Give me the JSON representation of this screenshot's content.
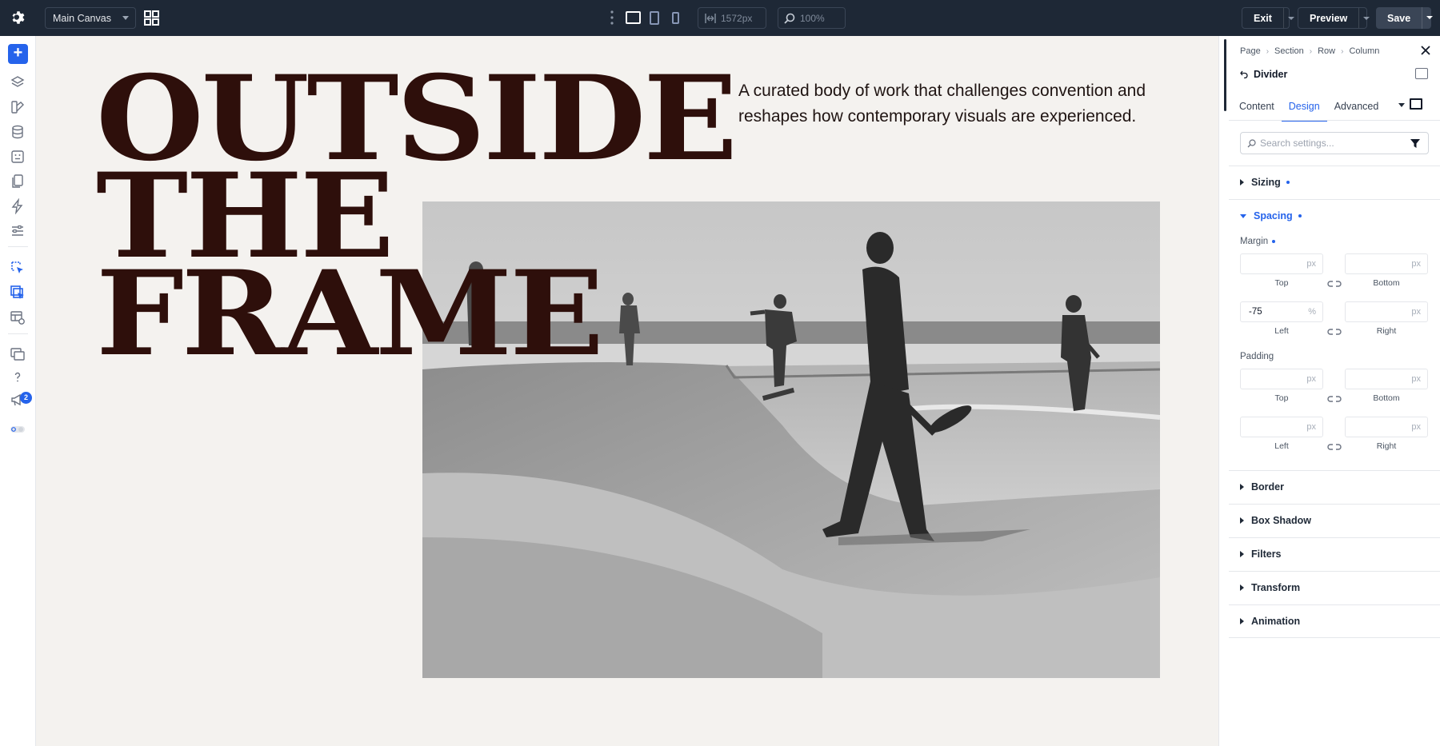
{
  "topbar": {
    "canvas_name": "Main Canvas",
    "width_value": "1572px",
    "zoom_value": "100%",
    "exit_label": "Exit",
    "preview_label": "Preview",
    "save_label": "Save"
  },
  "sidebar": {
    "notification_count": "2",
    "accent": "#2563eb"
  },
  "canvas": {
    "headline_lines": [
      "OUTSIDE",
      "THE",
      "FRAME"
    ],
    "tagline": "A curated body of work that challenges convention and reshapes how contemporary visuals are experienced.",
    "headline_color": "#2e0f0b"
  },
  "panel": {
    "breadcrumb": [
      "Page",
      "Section",
      "Row",
      "Column"
    ],
    "element_title": "Divider",
    "tabs": [
      "Content",
      "Design",
      "Advanced"
    ],
    "active_tab": "Design",
    "search_placeholder": "Search settings...",
    "sections": {
      "sizing": "Sizing",
      "spacing": "Spacing",
      "border": "Border",
      "box_shadow": "Box Shadow",
      "filters": "Filters",
      "transform": "Transform",
      "animation": "Animation"
    },
    "margin": {
      "label": "Margin",
      "top": {
        "label": "Top",
        "value": "",
        "unit": "px"
      },
      "bottom": {
        "label": "Bottom",
        "value": "",
        "unit": "px"
      },
      "left": {
        "label": "Left",
        "value": "-75",
        "unit": "%"
      },
      "right": {
        "label": "Right",
        "value": "",
        "unit": "px"
      }
    },
    "padding": {
      "label": "Padding",
      "top": {
        "label": "Top",
        "value": "",
        "unit": "px"
      },
      "bottom": {
        "label": "Bottom",
        "value": "",
        "unit": "px"
      },
      "left": {
        "label": "Left",
        "value": "",
        "unit": "px"
      },
      "right": {
        "label": "Right",
        "value": "",
        "unit": "px"
      }
    }
  }
}
